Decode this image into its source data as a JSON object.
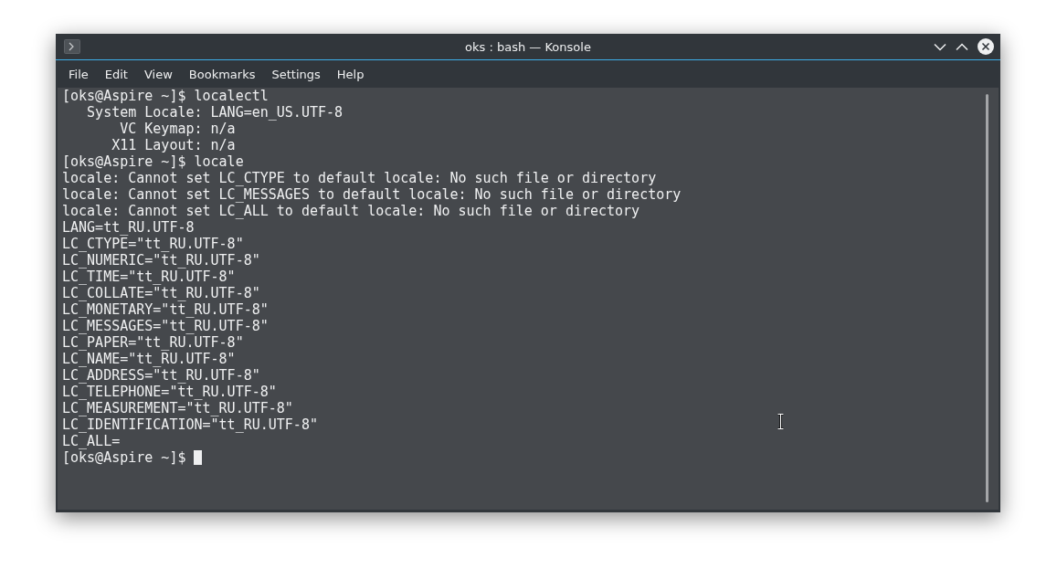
{
  "window": {
    "title": "oks : bash — Konsole"
  },
  "menu": [
    "File",
    "Edit",
    "View",
    "Bookmarks",
    "Settings",
    "Help"
  ],
  "terminal": {
    "lines": [
      "[oks@Aspire ~]$ localectl",
      "   System Locale: LANG=en_US.UTF-8",
      "       VC Keymap: n/a",
      "      X11 Layout: n/a",
      "[oks@Aspire ~]$ locale",
      "locale: Cannot set LC_CTYPE to default locale: No such file or directory",
      "locale: Cannot set LC_MESSAGES to default locale: No such file or directory",
      "locale: Cannot set LC_ALL to default locale: No such file or directory",
      "LANG=tt_RU.UTF-8",
      "LC_CTYPE=\"tt_RU.UTF-8\"",
      "LC_NUMERIC=\"tt_RU.UTF-8\"",
      "LC_TIME=\"tt_RU.UTF-8\"",
      "LC_COLLATE=\"tt_RU.UTF-8\"",
      "LC_MONETARY=\"tt_RU.UTF-8\"",
      "LC_MESSAGES=\"tt_RU.UTF-8\"",
      "LC_PAPER=\"tt_RU.UTF-8\"",
      "LC_NAME=\"tt_RU.UTF-8\"",
      "LC_ADDRESS=\"tt_RU.UTF-8\"",
      "LC_TELEPHONE=\"tt_RU.UTF-8\"",
      "LC_MEASUREMENT=\"tt_RU.UTF-8\"",
      "LC_IDENTIFICATION=\"tt_RU.UTF-8\"",
      "LC_ALL="
    ],
    "prompt": "[oks@Aspire ~]$"
  }
}
